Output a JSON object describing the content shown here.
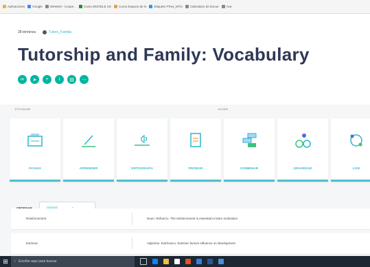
{
  "bookmarks": [
    {
      "label": "Aplicaciones",
      "color": "#e8b338"
    },
    {
      "label": "Google",
      "color": "#4285f4"
    },
    {
      "label": "WeWork - Coope...",
      "color": "#888888"
    },
    {
      "label": "Curso MOODLE CE",
      "color": "#1e8e3e"
    },
    {
      "label": "Curso Espacio de lo",
      "color": "#e8a33d"
    },
    {
      "label": "Etiquete #Tres_MTU",
      "color": "#1da1f2"
    },
    {
      "label": "Calendario de Escue",
      "color": "#888888"
    },
    {
      "label": "Ava",
      "color": "#888888"
    }
  ],
  "breadcrumb": {
    "terms_count": "28 términos",
    "user": "Tutors_Familia"
  },
  "title": "Tutorship and Family: Vocabulary",
  "socials": [
    "link-icon",
    "share-icon",
    "add-icon",
    "info-icon",
    "print-icon",
    "more-icon"
  ],
  "section_labels": {
    "study": "ESTUDIAR",
    "play": "JUGAR"
  },
  "modes": [
    {
      "label": "FICHAS",
      "icon": "flashcards-icon"
    },
    {
      "label": "APRENDER",
      "icon": "learn-icon"
    },
    {
      "label": "ORTOGRAFÍA",
      "icon": "spell-icon"
    },
    {
      "label": "PROBAR",
      "icon": "test-icon"
    },
    {
      "label": "COMBINAR",
      "icon": "match-icon"
    },
    {
      "label": "GRAVEDAD",
      "icon": "gravity-icon"
    },
    {
      "label": "LIVE",
      "icon": "live-icon"
    }
  ],
  "sort": {
    "label": "ORDENAR",
    "value": "Original"
  },
  "terms": [
    {
      "term": "Reinforcement",
      "definition": "Noun. Refuerzo. The reinforcement is essential to learn motivation"
    },
    {
      "term": "Extrinsic",
      "definition": "Adjective. Extrínseco. Extrinsic factors influence on development"
    }
  ],
  "taskbar": {
    "search_placeholder": "Escribe aquí para buscar"
  },
  "colors": {
    "accent": "#2ab7ca",
    "social": "#00b6a1",
    "title": "#2e3856",
    "taskbar": "#1c2733"
  }
}
